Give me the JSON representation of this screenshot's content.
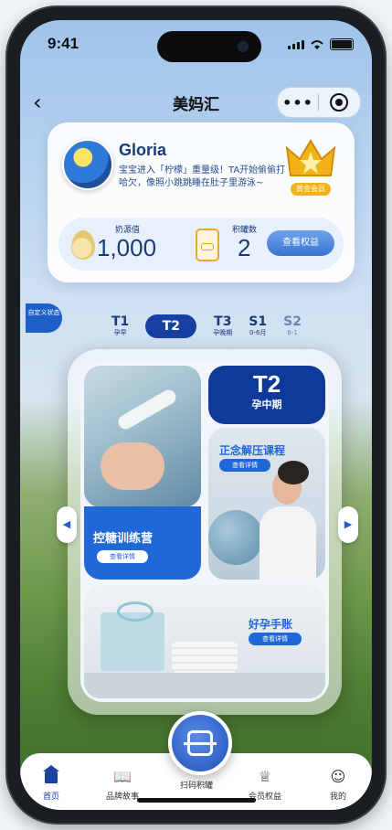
{
  "status": {
    "time": "9:41"
  },
  "nav": {
    "title": "美妈汇",
    "more": "•••"
  },
  "profile": {
    "name": "Gloria",
    "description": "宝宝进入「柠檬」重量级！TA开始偷偷打哈欠，像照小跳跳睡在肚子里游泳~",
    "level_badge": "黄金会员",
    "milk_label": "奶源值",
    "milk_value": "1,000",
    "can_label": "积罐数",
    "can_value": "2",
    "rights_button": "查看权益"
  },
  "custom_tag": "自定义状态",
  "stages": [
    {
      "code": "T1",
      "sub": "孕早"
    },
    {
      "code": "T2",
      "sub": ""
    },
    {
      "code": "T3",
      "sub": "孕晚期"
    },
    {
      "code": "S1",
      "sub": "0-6月"
    },
    {
      "code": "S2",
      "sub": "6-1"
    }
  ],
  "card": {
    "stage_code": "T2",
    "stage_name": "孕中期",
    "camp_title": "控糖训练营",
    "camp_button": "查看详情",
    "course_title": "正念解压课程",
    "course_button": "查看详情",
    "handbook_title": "好孕手账",
    "handbook_button": "查看详情"
  },
  "tabs": [
    {
      "label": "首页",
      "icon": "home-icon"
    },
    {
      "label": "品牌故事",
      "icon": "book-icon"
    },
    {
      "label": "扫码积罐",
      "icon": "scan-icon"
    },
    {
      "label": "会员权益",
      "icon": "crown-icon"
    },
    {
      "label": "我的",
      "icon": "user-icon"
    }
  ],
  "colors": {
    "accent": "#1740a0",
    "button": "#1f68d6"
  }
}
